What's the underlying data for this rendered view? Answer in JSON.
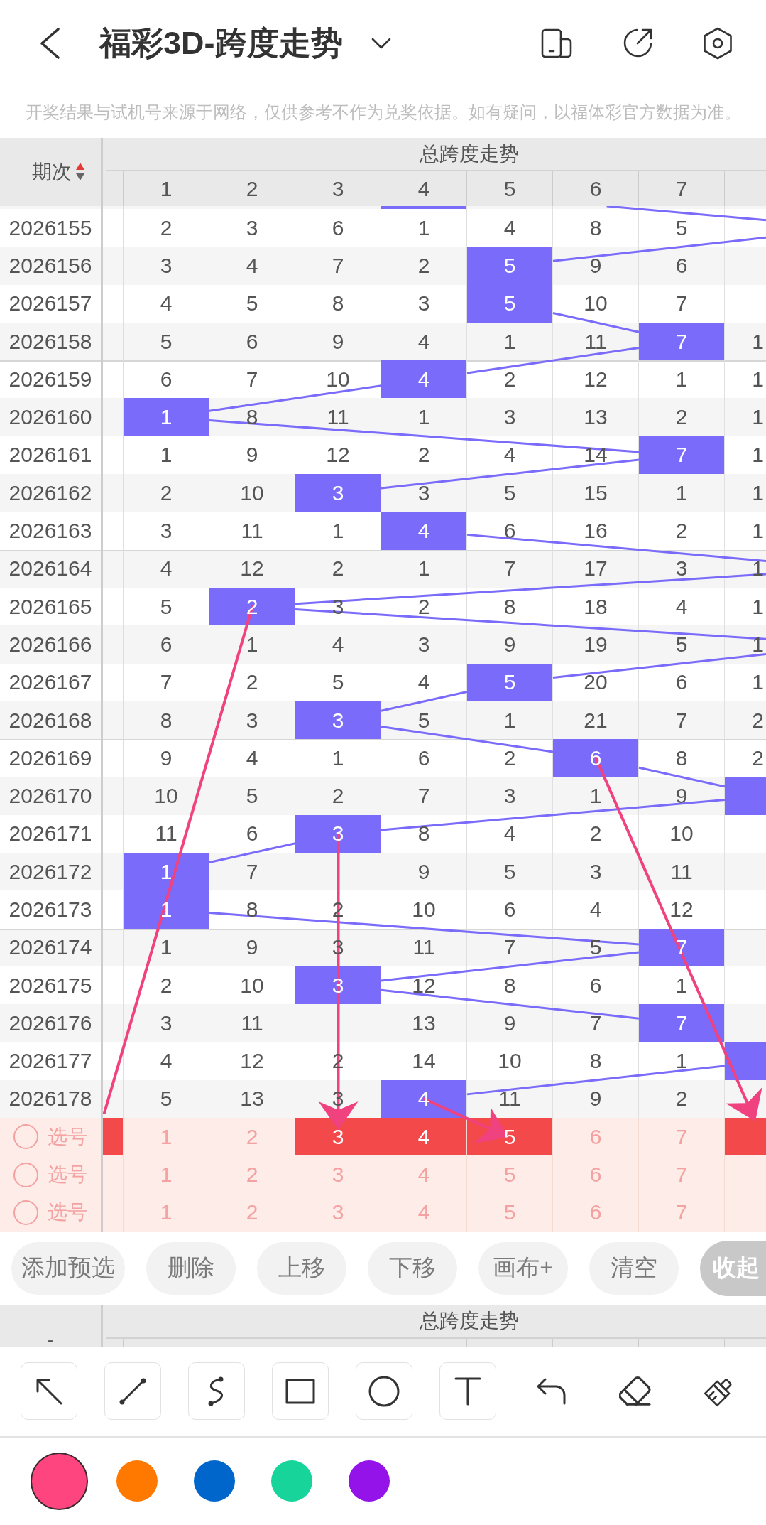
{
  "header": {
    "title": "福彩3D-跨度走势"
  },
  "notice": "开奖结果与试机号来源于网络，仅供参考不作为兑奖依据。如有疑问，以福体彩官方数据为准。",
  "table": {
    "period_heading": "期次",
    "group_heading": "总跨度走势",
    "columns": [
      "1",
      "2",
      "3",
      "4",
      "5",
      "6",
      "7"
    ],
    "rows": [
      {
        "kind": "sliver",
        "cells": [
          null,
          null,
          null,
          {
            "hit": true
          },
          null,
          null,
          null,
          null
        ]
      },
      {
        "kind": "period",
        "period": "2026155",
        "cells": [
          {
            "text": "2",
            "hit": false
          },
          {
            "text": "3",
            "hit": false
          },
          {
            "text": "6",
            "hit": false
          },
          {
            "text": "1",
            "hit": false
          },
          {
            "text": "4",
            "hit": false
          },
          {
            "text": "8",
            "hit": false
          },
          {
            "text": "5",
            "hit": false
          },
          {
            "hit": false
          }
        ]
      },
      {
        "kind": "period",
        "period": "2026156",
        "cells": [
          {
            "text": "3",
            "hit": false
          },
          {
            "text": "4",
            "hit": false
          },
          {
            "text": "7",
            "hit": false
          },
          {
            "text": "2",
            "hit": false
          },
          {
            "text": "5",
            "hit": true
          },
          {
            "text": "9",
            "hit": false
          },
          {
            "text": "6",
            "hit": false
          },
          {
            "hit": false
          }
        ]
      },
      {
        "kind": "period",
        "period": "2026157",
        "cells": [
          {
            "text": "4",
            "hit": false
          },
          {
            "text": "5",
            "hit": false
          },
          {
            "text": "8",
            "hit": false
          },
          {
            "text": "3",
            "hit": false
          },
          {
            "text": "5",
            "hit": true
          },
          {
            "text": "10",
            "hit": false
          },
          {
            "text": "7",
            "hit": false
          },
          {
            "hit": false
          }
        ]
      },
      {
        "kind": "period",
        "period": "2026158",
        "cells": [
          {
            "text": "5",
            "hit": false
          },
          {
            "text": "6",
            "hit": false
          },
          {
            "text": "9",
            "hit": false
          },
          {
            "text": "4",
            "hit": false
          },
          {
            "text": "1",
            "hit": false
          },
          {
            "text": "11",
            "hit": false
          },
          {
            "text": "7",
            "hit": true
          },
          {
            "text": "1",
            "hit": false
          }
        ]
      },
      {
        "kind": "period",
        "period": "2026159",
        "cells": [
          {
            "text": "6",
            "hit": false
          },
          {
            "text": "7",
            "hit": false
          },
          {
            "text": "10",
            "hit": false
          },
          {
            "text": "4",
            "hit": true
          },
          {
            "text": "2",
            "hit": false
          },
          {
            "text": "12",
            "hit": false
          },
          {
            "text": "1",
            "hit": false
          },
          {
            "text": "1",
            "hit": false
          }
        ]
      },
      {
        "kind": "period",
        "period": "2026160",
        "cells": [
          {
            "text": "1",
            "hit": true
          },
          {
            "text": "8",
            "hit": false
          },
          {
            "text": "11",
            "hit": false
          },
          {
            "text": "1",
            "hit": false
          },
          {
            "text": "3",
            "hit": false
          },
          {
            "text": "13",
            "hit": false
          },
          {
            "text": "2",
            "hit": false
          },
          {
            "text": "1",
            "hit": false
          }
        ]
      },
      {
        "kind": "period",
        "period": "2026161",
        "cells": [
          {
            "text": "1",
            "hit": false
          },
          {
            "text": "9",
            "hit": false
          },
          {
            "text": "12",
            "hit": false
          },
          {
            "text": "2",
            "hit": false
          },
          {
            "text": "4",
            "hit": false
          },
          {
            "text": "14",
            "hit": false
          },
          {
            "text": "7",
            "hit": true
          },
          {
            "text": "1",
            "hit": false
          }
        ]
      },
      {
        "kind": "period",
        "period": "2026162",
        "cells": [
          {
            "text": "2",
            "hit": false
          },
          {
            "text": "10",
            "hit": false
          },
          {
            "text": "3",
            "hit": true
          },
          {
            "text": "3",
            "hit": false
          },
          {
            "text": "5",
            "hit": false
          },
          {
            "text": "15",
            "hit": false
          },
          {
            "text": "1",
            "hit": false
          },
          {
            "text": "1",
            "hit": false
          }
        ]
      },
      {
        "kind": "period",
        "period": "2026163",
        "cells": [
          {
            "text": "3",
            "hit": false
          },
          {
            "text": "11",
            "hit": false
          },
          {
            "text": "1",
            "hit": false
          },
          {
            "text": "4",
            "hit": true
          },
          {
            "text": "6",
            "hit": false
          },
          {
            "text": "16",
            "hit": false
          },
          {
            "text": "2",
            "hit": false
          },
          {
            "text": "1",
            "hit": false
          }
        ]
      },
      {
        "kind": "period",
        "period": "2026164",
        "cells": [
          {
            "text": "4",
            "hit": false
          },
          {
            "text": "12",
            "hit": false
          },
          {
            "text": "2",
            "hit": false
          },
          {
            "text": "1",
            "hit": false
          },
          {
            "text": "7",
            "hit": false
          },
          {
            "text": "17",
            "hit": false
          },
          {
            "text": "3",
            "hit": false
          },
          {
            "text": "1",
            "hit": false
          }
        ]
      },
      {
        "kind": "period",
        "period": "2026165",
        "cells": [
          {
            "text": "5",
            "hit": false
          },
          {
            "text": "2",
            "hit": true
          },
          {
            "text": "3",
            "hit": false
          },
          {
            "text": "2",
            "hit": false
          },
          {
            "text": "8",
            "hit": false
          },
          {
            "text": "18",
            "hit": false
          },
          {
            "text": "4",
            "hit": false
          },
          {
            "text": "1",
            "hit": false
          }
        ]
      },
      {
        "kind": "period",
        "period": "2026166",
        "cells": [
          {
            "text": "6",
            "hit": false
          },
          {
            "text": "1",
            "hit": false
          },
          {
            "text": "4",
            "hit": false
          },
          {
            "text": "3",
            "hit": false
          },
          {
            "text": "9",
            "hit": false
          },
          {
            "text": "19",
            "hit": false
          },
          {
            "text": "5",
            "hit": false
          },
          {
            "text": "1",
            "hit": false
          }
        ]
      },
      {
        "kind": "period",
        "period": "2026167",
        "cells": [
          {
            "text": "7",
            "hit": false
          },
          {
            "text": "2",
            "hit": false
          },
          {
            "text": "5",
            "hit": false
          },
          {
            "text": "4",
            "hit": false
          },
          {
            "text": "5",
            "hit": true
          },
          {
            "text": "20",
            "hit": false
          },
          {
            "text": "6",
            "hit": false
          },
          {
            "text": "1",
            "hit": false
          }
        ]
      },
      {
        "kind": "period",
        "period": "2026168",
        "cells": [
          {
            "text": "8",
            "hit": false
          },
          {
            "text": "3",
            "hit": false
          },
          {
            "text": "3",
            "hit": true
          },
          {
            "text": "5",
            "hit": false
          },
          {
            "text": "1",
            "hit": false
          },
          {
            "text": "21",
            "hit": false
          },
          {
            "text": "7",
            "hit": false
          },
          {
            "text": "2",
            "hit": false
          }
        ]
      },
      {
        "kind": "period",
        "period": "2026169",
        "cells": [
          {
            "text": "9",
            "hit": false
          },
          {
            "text": "4",
            "hit": false
          },
          {
            "text": "1",
            "hit": false
          },
          {
            "text": "6",
            "hit": false
          },
          {
            "text": "2",
            "hit": false
          },
          {
            "text": "6",
            "hit": true
          },
          {
            "text": "8",
            "hit": false
          },
          {
            "text": "2",
            "hit": false
          }
        ]
      },
      {
        "kind": "period",
        "period": "2026170",
        "cells": [
          {
            "text": "10",
            "hit": false
          },
          {
            "text": "5",
            "hit": false
          },
          {
            "text": "2",
            "hit": false
          },
          {
            "text": "7",
            "hit": false
          },
          {
            "text": "3",
            "hit": false
          },
          {
            "text": "1",
            "hit": false
          },
          {
            "text": "9",
            "hit": false
          },
          {
            "hit": true
          }
        ]
      },
      {
        "kind": "period",
        "period": "2026171",
        "cells": [
          {
            "text": "11",
            "hit": false
          },
          {
            "text": "6",
            "hit": false
          },
          {
            "text": "3",
            "hit": true
          },
          {
            "text": "8",
            "hit": false
          },
          {
            "text": "4",
            "hit": false
          },
          {
            "text": "2",
            "hit": false
          },
          {
            "text": "10",
            "hit": false
          },
          {
            "hit": false
          }
        ]
      },
      {
        "kind": "period",
        "period": "2026172",
        "cells": [
          {
            "text": "1",
            "hit": true
          },
          {
            "text": "7",
            "hit": false
          },
          {
            "hit": false
          },
          {
            "text": "9",
            "hit": false
          },
          {
            "text": "5",
            "hit": false
          },
          {
            "text": "3",
            "hit": false
          },
          {
            "text": "11",
            "hit": false
          },
          {
            "hit": false
          }
        ]
      },
      {
        "kind": "period",
        "period": "2026173",
        "cells": [
          {
            "text": "1",
            "hit": true
          },
          {
            "text": "8",
            "hit": false
          },
          {
            "text": "2",
            "hit": false
          },
          {
            "text": "10",
            "hit": false
          },
          {
            "text": "6",
            "hit": false
          },
          {
            "text": "4",
            "hit": false
          },
          {
            "text": "12",
            "hit": false
          },
          {
            "hit": false
          }
        ]
      },
      {
        "kind": "period",
        "period": "2026174",
        "cells": [
          {
            "text": "1",
            "hit": false
          },
          {
            "text": "9",
            "hit": false
          },
          {
            "text": "3",
            "hit": false
          },
          {
            "text": "11",
            "hit": false
          },
          {
            "text": "7",
            "hit": false
          },
          {
            "text": "5",
            "hit": false
          },
          {
            "text": "7",
            "hit": true
          },
          {
            "hit": false
          }
        ]
      },
      {
        "kind": "period",
        "period": "2026175",
        "cells": [
          {
            "text": "2",
            "hit": false
          },
          {
            "text": "10",
            "hit": false
          },
          {
            "text": "3",
            "hit": true
          },
          {
            "text": "12",
            "hit": false
          },
          {
            "text": "8",
            "hit": false
          },
          {
            "text": "6",
            "hit": false
          },
          {
            "text": "1",
            "hit": false
          },
          {
            "hit": false
          }
        ]
      },
      {
        "kind": "period",
        "period": "2026176",
        "cells": [
          {
            "text": "3",
            "hit": false
          },
          {
            "text": "11",
            "hit": false
          },
          {
            "hit": false
          },
          {
            "text": "13",
            "hit": false
          },
          {
            "text": "9",
            "hit": false
          },
          {
            "text": "7",
            "hit": false
          },
          {
            "text": "7",
            "hit": true
          },
          {
            "hit": false
          }
        ]
      },
      {
        "kind": "period",
        "period": "2026177",
        "cells": [
          {
            "text": "4",
            "hit": false
          },
          {
            "text": "12",
            "hit": false
          },
          {
            "text": "2",
            "hit": false
          },
          {
            "text": "14",
            "hit": false
          },
          {
            "text": "10",
            "hit": false
          },
          {
            "text": "8",
            "hit": false
          },
          {
            "text": "1",
            "hit": false
          },
          {
            "hit": true
          }
        ]
      },
      {
        "kind": "period",
        "period": "2026178",
        "cells": [
          {
            "text": "5",
            "hit": false
          },
          {
            "text": "13",
            "hit": false
          },
          {
            "text": "3",
            "hit": false
          },
          {
            "text": "4",
            "hit": true
          },
          {
            "text": "11",
            "hit": false
          },
          {
            "text": "9",
            "hit": false
          },
          {
            "text": "2",
            "hit": false
          },
          {
            "hit": false
          }
        ]
      }
    ],
    "pick_rows": [
      {
        "label": "选号",
        "checked": false,
        "cells": [
          {
            "selected": true
          },
          {
            "text": "1",
            "selected": false
          },
          {
            "text": "2",
            "selected": false
          },
          {
            "text": "3",
            "selected": true
          },
          {
            "text": "4",
            "selected": true
          },
          {
            "text": "5",
            "selected": true
          },
          {
            "text": "6",
            "selected": false
          },
          {
            "text": "7",
            "selected": false
          },
          {
            "selected": true
          }
        ]
      },
      {
        "label": "选号",
        "checked": false,
        "cells": [
          {
            "selected": false
          },
          {
            "text": "1",
            "selected": false
          },
          {
            "text": "2",
            "selected": false
          },
          {
            "text": "3",
            "selected": false
          },
          {
            "text": "4",
            "selected": false
          },
          {
            "text": "5",
            "selected": false
          },
          {
            "text": "6",
            "selected": false
          },
          {
            "text": "7",
            "selected": false
          },
          {
            "selected": false
          }
        ]
      },
      {
        "label": "选号",
        "checked": false,
        "cells": [
          {
            "selected": false
          },
          {
            "text": "1",
            "selected": false
          },
          {
            "text": "2",
            "selected": false
          },
          {
            "text": "3",
            "selected": false
          },
          {
            "text": "4",
            "selected": false
          },
          {
            "text": "5",
            "selected": false
          },
          {
            "text": "6",
            "selected": false
          },
          {
            "text": "7",
            "selected": false
          },
          {
            "selected": false
          }
        ]
      }
    ]
  },
  "annotations": [
    {
      "kind": "arrow"
    },
    {
      "kind": "arrow"
    },
    {
      "kind": "arrow"
    },
    {
      "kind": "arrow"
    }
  ],
  "actions": [
    "添加预选",
    "删除",
    "上移",
    "下移",
    "画布+",
    "清空"
  ],
  "collapse_button": "收起",
  "lower_header": {
    "period_heading": "-",
    "group_heading": "总跨度走势"
  },
  "draw_tools": [
    {
      "kind": "arrow"
    },
    {
      "kind": "line"
    },
    {
      "kind": "curve"
    },
    {
      "kind": "rectangle"
    },
    {
      "kind": "ellipse"
    },
    {
      "kind": "text"
    }
  ],
  "edit_tools": [
    {
      "kind": "undo"
    },
    {
      "kind": "eraser"
    },
    {
      "kind": "brush"
    }
  ],
  "palette": [
    {
      "color": "#ff4580",
      "selected": true
    },
    {
      "color": "#ff7800",
      "selected": false
    },
    {
      "color": "#0066cc",
      "selected": false
    },
    {
      "color": "#17d49a",
      "selected": false
    },
    {
      "color": "#9313e9",
      "selected": false
    }
  ]
}
